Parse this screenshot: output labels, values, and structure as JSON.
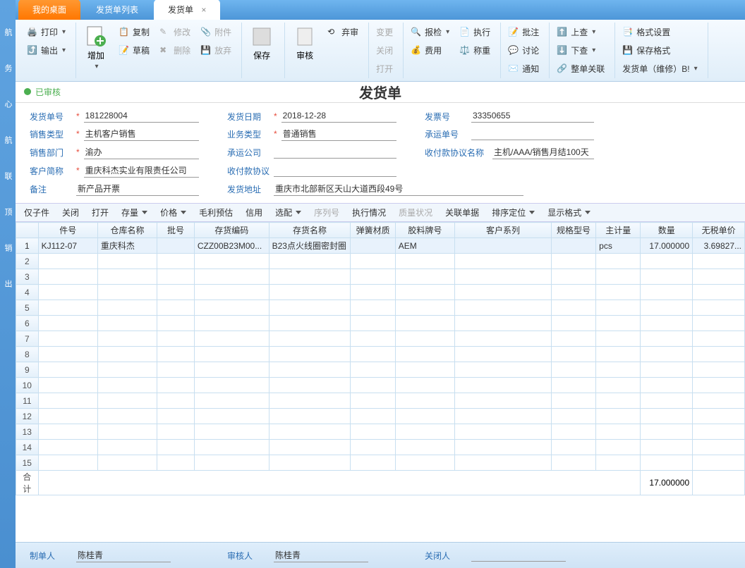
{
  "tabs": {
    "desktop": "我的桌面",
    "list": "发货单列表",
    "current": "发货单"
  },
  "ribbon": {
    "print": "打印",
    "export": "输出",
    "add": "增加",
    "copy": "复制",
    "modify": "修改",
    "attach": "附件",
    "draft": "草稿",
    "delete": "删除",
    "discard": "放弃",
    "save": "保存",
    "audit": "审核",
    "change": "变更",
    "close": "关闭",
    "open": "打开",
    "abandon": "弃审",
    "inspect": "报检",
    "cost": "费用",
    "execute": "执行",
    "weigh": "称重",
    "approve": "批注",
    "discuss": "讨论",
    "notify": "通知",
    "lookup": "上查",
    "lookdown": "下查",
    "wholebill": "整单关联",
    "formatset": "格式设置",
    "saveformat": "保存格式",
    "shippingbill": "发货单（维修）B!"
  },
  "status": {
    "audited": "已审核"
  },
  "docTitle": "发货单",
  "form": {
    "shipNoLabel": "发货单号",
    "shipNo": "181228004",
    "shipDateLabel": "发货日期",
    "shipDate": "2018-12-28",
    "invoiceLabel": "发票号",
    "invoice": "33350655",
    "saleTypeLabel": "销售类型",
    "saleType": "主机客户销售",
    "bizTypeLabel": "业务类型",
    "bizType": "普通销售",
    "carrierNoLabel": "承运单号",
    "carrierNo": "",
    "saleDeptLabel": "销售部门",
    "saleDept": "渝办",
    "carrierLabel": "承运公司",
    "carrier": "",
    "payTermNameLabel": "收付款协议名称",
    "payTermName": "主机/AAA/销售月结100天",
    "custLabel": "客户简称",
    "cust": "重庆科杰实业有限责任公司",
    "payTermLabel": "收付款协议",
    "payTerm": "",
    "remarkLabel": "备注",
    "remark": "新产品开票",
    "addrLabel": "发货地址",
    "addr": "重庆市北部新区天山大道西段49号"
  },
  "subbar": {
    "onlySub": "仅子件",
    "close": "关闭",
    "open": "打开",
    "stock": "存量",
    "price": "价格",
    "gross": "毛利预估",
    "credit": "信用",
    "match": "选配",
    "serial": "序列号",
    "exec": "执行情况",
    "quality": "质量状况",
    "rel": "关联单据",
    "sort": "排序定位",
    "display": "显示格式"
  },
  "grid": {
    "headers": {
      "part": "件号",
      "warehouse": "仓库名称",
      "batch": "批号",
      "code": "存货编码",
      "name": "存货名称",
      "spring": "弹簧材质",
      "brand": "胶料牌号",
      "series": "客户系列",
      "spec": "规格型号",
      "uom": "主计量",
      "qty": "数量",
      "price": "无税单价"
    },
    "rows": [
      {
        "part": "KJ112-07",
        "warehouse": "重庆科杰",
        "batch": "",
        "code": "CZZ00B23M00...",
        "name": "B23点火线圈密封圈",
        "spring": "",
        "brand": "AEM",
        "series": "",
        "spec": "",
        "uom": "pcs",
        "qty": "17.000000",
        "price": "3.69827..."
      }
    ],
    "totalLabel": "合计",
    "totalQty": "17.000000"
  },
  "footer": {
    "makerLabel": "制单人",
    "maker": "陈桂青",
    "auditorLabel": "审核人",
    "auditor": "陈桂青",
    "closerLabel": "关闭人",
    "closer": ""
  },
  "sidebar": [
    "航",
    "务",
    "心",
    "航",
    "联",
    "顶",
    "销",
    "出"
  ]
}
